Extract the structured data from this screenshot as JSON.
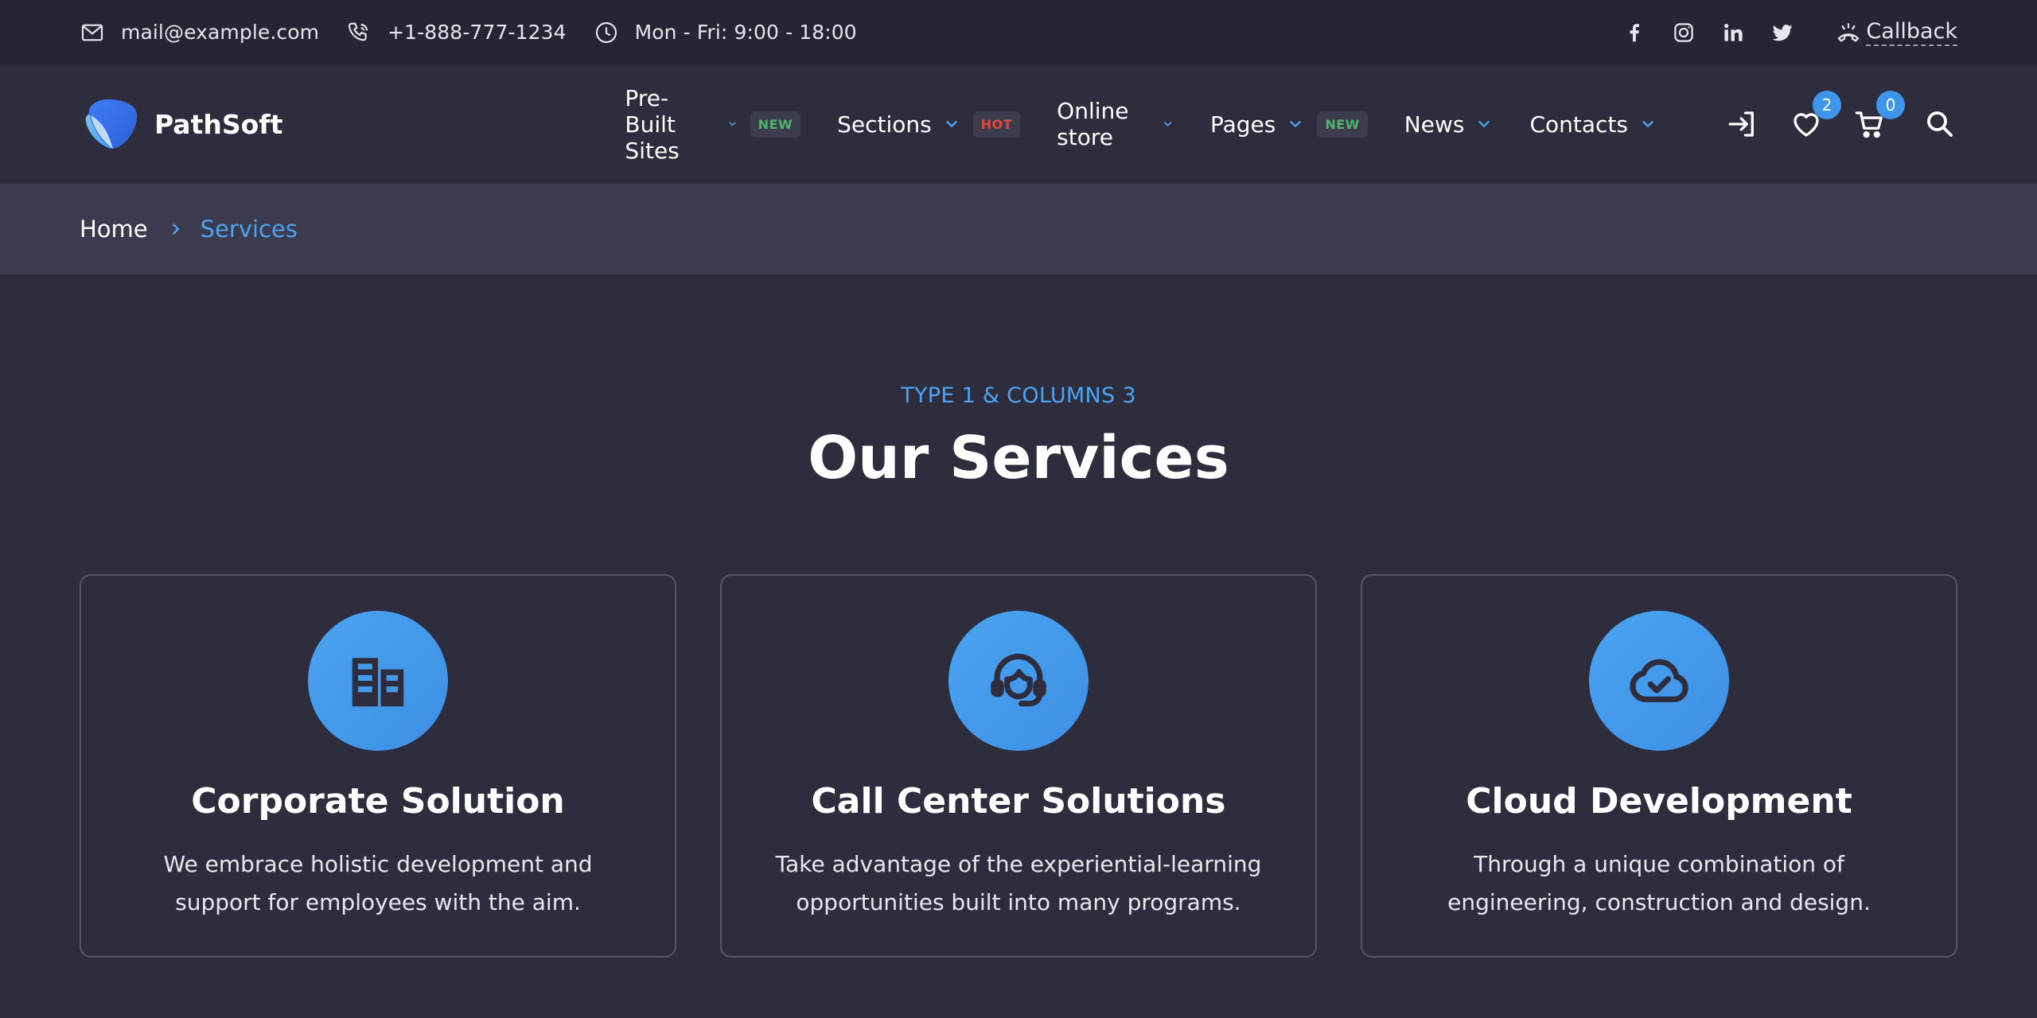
{
  "topbar": {
    "email": "mail@example.com",
    "phone": "+1-888-777-1234",
    "hours": "Mon - Fri: 9:00 - 18:00",
    "social": [
      "facebook-icon",
      "instagram-icon",
      "linkedin-icon",
      "twitter-icon"
    ],
    "callback_label": "Callback"
  },
  "header": {
    "brand": "PathSoft",
    "nav": [
      {
        "label": "Pre-Built Sites",
        "badge": "NEW"
      },
      {
        "label": "Sections",
        "badge": "HOT"
      },
      {
        "label": "Online store",
        "badge": ""
      },
      {
        "label": "Pages",
        "badge": "NEW"
      },
      {
        "label": "News",
        "badge": ""
      },
      {
        "label": "Contacts",
        "badge": ""
      }
    ],
    "wishlist_count": "2",
    "cart_count": "0"
  },
  "breadcrumb": {
    "home": "Home",
    "current": "Services"
  },
  "section": {
    "eyebrow": "TYPE 1 & COLUMNS 3",
    "title": "Our Services"
  },
  "cards": [
    {
      "icon": "building-icon",
      "title": "Corporate Solution",
      "text": "We embrace holistic development and support for employees with the aim."
    },
    {
      "icon": "headset-icon",
      "title": "Call Center Solutions",
      "text": "Take advantage of the experiential-learning opportunities built into many programs."
    },
    {
      "icon": "cloud-check-icon",
      "title": "Cloud Development",
      "text": "Through a unique combination of engineering, construction and design."
    }
  ],
  "colors": {
    "accent": "#4da3ef",
    "background": "#2e2d3d",
    "topbar": "#252533",
    "breadcrumb_bar": "#3b3a4f",
    "badge_new": "#4fb36a",
    "badge_hot": "#e0483f"
  }
}
